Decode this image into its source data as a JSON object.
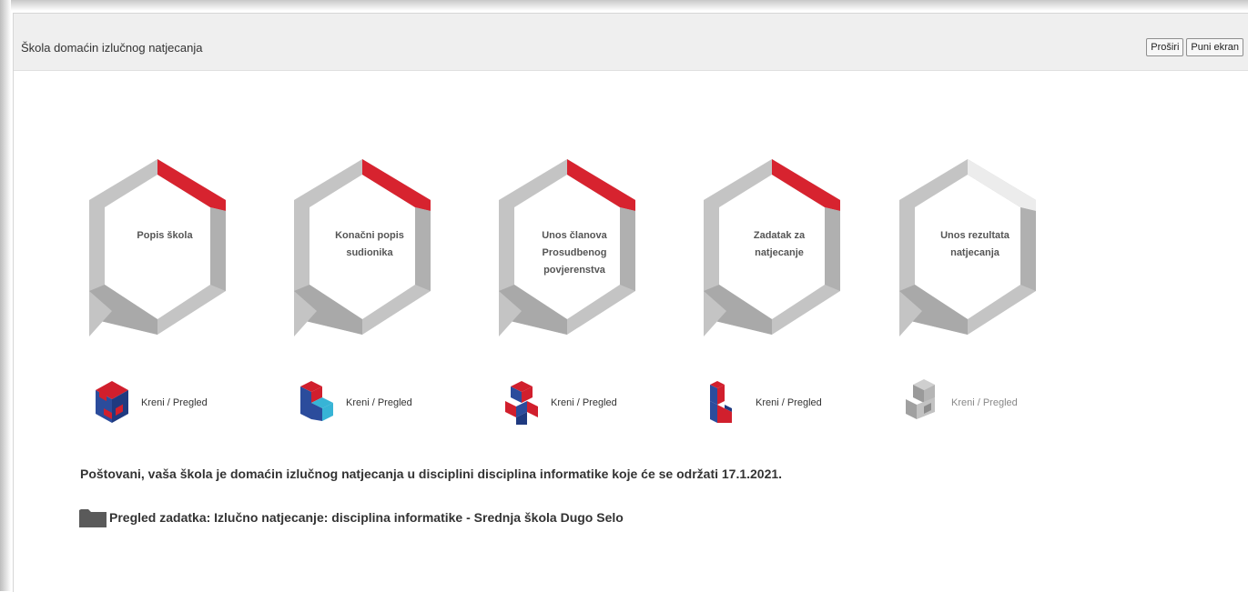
{
  "window": {
    "title": "Škola domaćin izlučnog natjecanja",
    "buttons": {
      "expand": "Proširi",
      "fullscreen": "Puni ekran"
    }
  },
  "steps": [
    {
      "label": "Popis škola",
      "action": "Kreni / Pregled",
      "active": true,
      "icon": "cube-grid-icon"
    },
    {
      "label": "Konačni popis\nsudionika",
      "action": "Kreni / Pregled",
      "active": true,
      "icon": "cube-steps-icon"
    },
    {
      "label": "Unos članova\nProsudbenog\npovjerenstva",
      "action": "Kreni / Pregled",
      "active": true,
      "icon": "cube-stack-icon"
    },
    {
      "label": "Zadatak za\nnatjecanje",
      "action": "Kreni / Pregled",
      "active": true,
      "icon": "cube-column-icon"
    },
    {
      "label": "Unos rezultata\nnatjecanja",
      "action": "Kreni / Pregled",
      "active": false,
      "icon": "cube-grey-icon"
    }
  ],
  "notice": "Poštovani, vaša škola je domaćin izlučnog natjecanja u disciplini disciplina informatike koje će se održati 17.1.2021.",
  "task_link": {
    "icon": "folder-icon",
    "label": "Pregled zadatka: Izlučno natjecanje: disciplina informatike - Srednja škola Dugo Selo"
  },
  "colors": {
    "hex_grey": "#c4c4c4",
    "hex_grey_dark": "#a9a9a9",
    "accent_red": "#d7232f",
    "inactive_light": "#ececec",
    "cube_blue": "#2b4c9c",
    "cube_red": "#d11f2d",
    "cube_cyan": "#37b4d6"
  }
}
